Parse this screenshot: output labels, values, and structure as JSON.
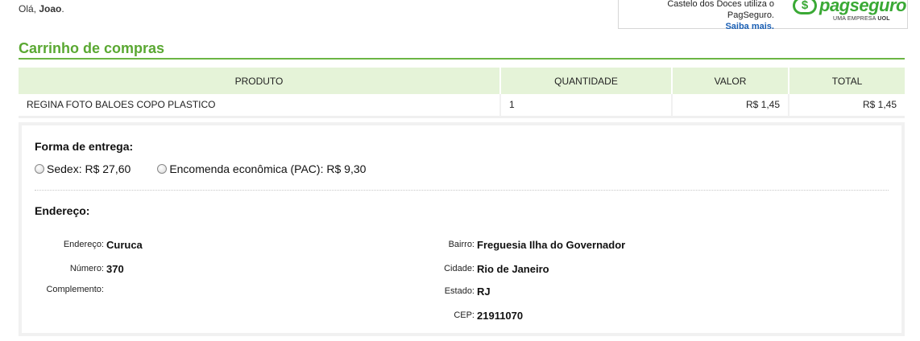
{
  "header": {
    "greeting_prefix": "Olá,",
    "user_name": "Joao",
    "greeting_suffix": "."
  },
  "pagseguro": {
    "notice": "Castelo dos Doces utiliza o PagSeguro.",
    "link": "Saiba mais.",
    "logo_mark": "$",
    "logo_word": "pagseguro",
    "logo_sub": "UMA EMPRESA",
    "logo_sub_bold": "UOL",
    "accent": "#3aa935"
  },
  "cart": {
    "title": "Carrinho de compras",
    "columns": [
      "PRODUTO",
      "QUANTIDADE",
      "VALOR",
      "TOTAL"
    ],
    "rows": [
      {
        "produto": "REGINA FOTO BALOES COPO PLASTICO",
        "quantidade": "1",
        "valor": "R$ 1,45",
        "total": "R$ 1,45"
      }
    ],
    "header_bg": "#e5f3d8",
    "title_color": "#5aa832"
  },
  "shipping": {
    "label": "Forma de entrega:",
    "options": [
      {
        "name": "Sedex:",
        "price": "R$ 27,60",
        "selected": false
      },
      {
        "name": "Encomenda econômica (PAC):",
        "price": "R$ 9,30",
        "selected": false
      }
    ]
  },
  "address": {
    "label": "Endereço:",
    "left": [
      {
        "label": "Endereço:",
        "value": "Curuca"
      },
      {
        "label": "Número:",
        "value": "370"
      },
      {
        "label": "Complemento:",
        "value": ""
      }
    ],
    "right": [
      {
        "label": "Bairro:",
        "value": "Freguesia Ilha do Governador"
      },
      {
        "label": "Cidade:",
        "value": "Rio de Janeiro"
      },
      {
        "label": "Estado:",
        "value": "RJ"
      },
      {
        "label": "CEP:",
        "value": "21911070"
      }
    ]
  }
}
